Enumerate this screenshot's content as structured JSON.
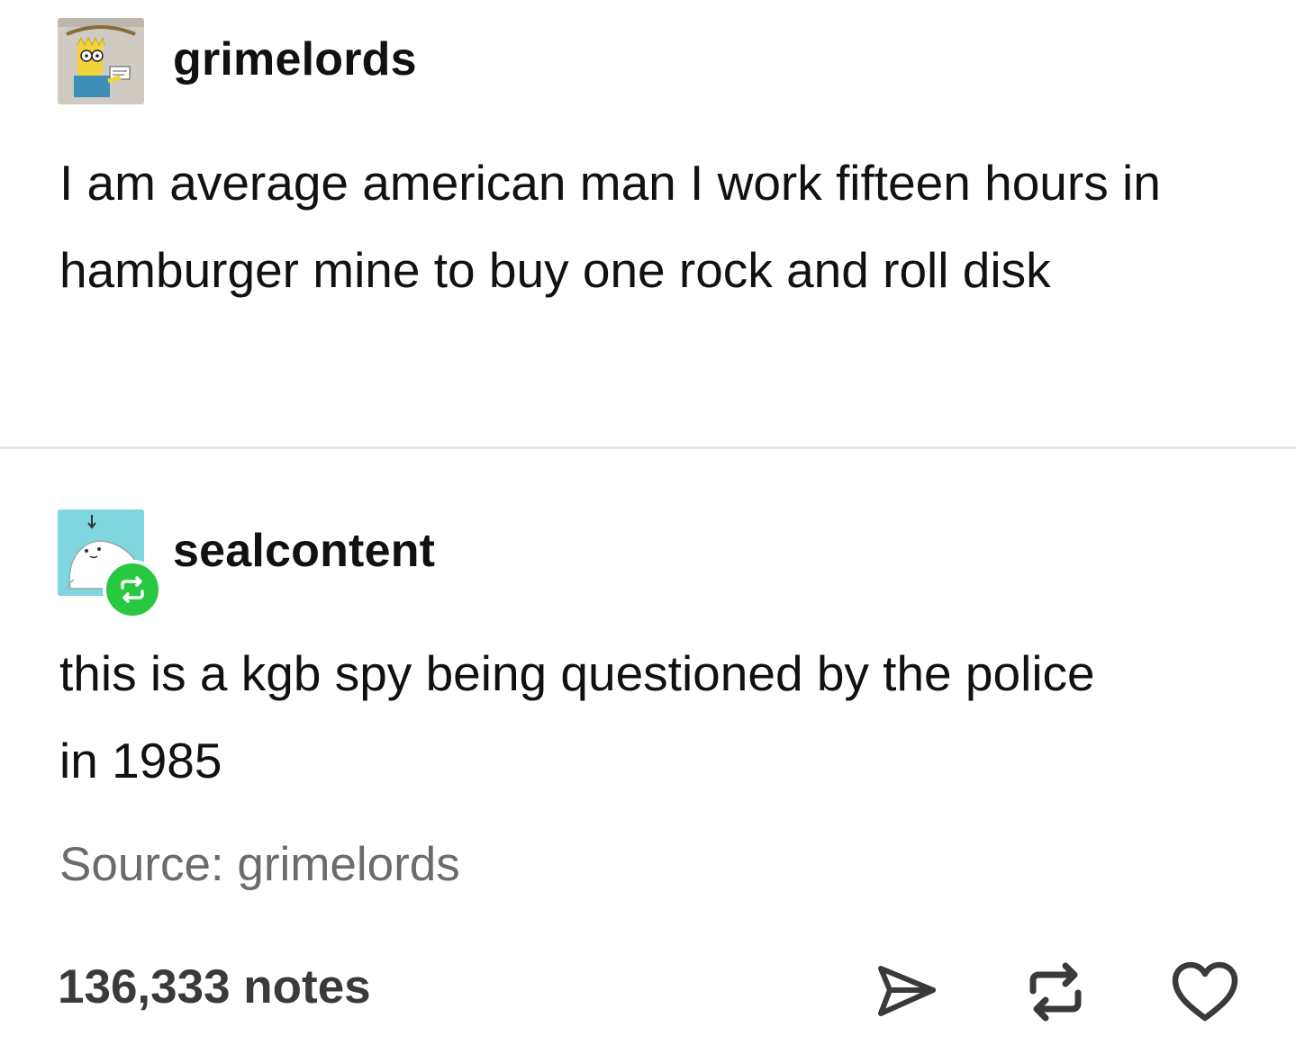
{
  "post": {
    "author": "grimelords",
    "text": "I am average american man I work fifteen hours in hamburger mine to buy one rock and roll disk"
  },
  "reply": {
    "author": "sealcontent",
    "text": "this is a kgb spy being questioned by the police in 1985"
  },
  "source": "Source: grimelords",
  "footer": {
    "notes": "136,333 notes",
    "actions": [
      "send-icon",
      "reblog-icon",
      "heart-icon"
    ]
  },
  "colors": {
    "reblog_badge": "#28c840",
    "seal_avatar_bg": "#7fd6df",
    "text": "#111111",
    "muted_text": "#6b6b6b",
    "divider": "#e6e6e6"
  }
}
